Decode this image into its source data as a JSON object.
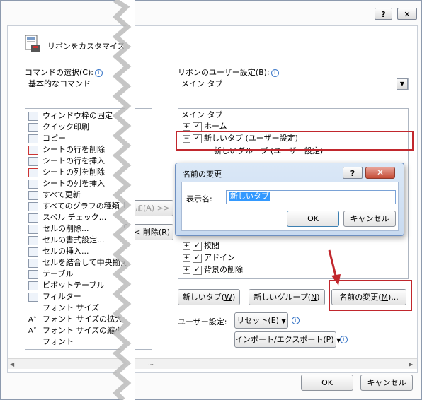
{
  "titlebar": {
    "help": "?",
    "close": "✕"
  },
  "header": {
    "title": "リボンをカスタマイズ"
  },
  "left": {
    "label": "コマンドの選択(",
    "label_key": "C",
    "label_end": "):",
    "combo_value": "基本的なコマンド",
    "items": [
      "ウィンドウ枠の固定",
      "クイック印刷",
      "コピー",
      "シートの行を削除",
      "シートの行を挿入",
      "シートの列を削除",
      "シートの列を挿入",
      "すべて更新",
      "すべてのグラフの種類",
      "スペル チェック...",
      "セルの削除...",
      "セルの書式設定...",
      "セルの挿入...",
      "セルを結合して中央揃え",
      "テーブル",
      "ピボットテーブル",
      "フィルター",
      "フォント サイズ",
      "フォント サイズの拡大",
      "フォント サイズの縮小",
      "フォント"
    ]
  },
  "middle": {
    "add_button": "追加(A) >>",
    "remove_button": "<< 削除(R)"
  },
  "right": {
    "label": "リボンのユーザー設定(",
    "label_key": "B",
    "label_end": "):",
    "combo_value": "メイン タブ",
    "tree_header": "メイン タブ",
    "tree": [
      {
        "expander": "+",
        "checked": "✓",
        "label": "ホーム"
      },
      {
        "expander": "−",
        "checked": "✓",
        "label": "新しいタブ (ユーザー設定)"
      },
      {
        "expander": "",
        "checked": "",
        "label": "新しいグループ (ユーザー設定)"
      },
      {
        "expander": "+",
        "checked": "✓",
        "label": "校閲"
      },
      {
        "expander": "+",
        "checked": "✓",
        "label": "アドイン"
      },
      {
        "expander": "+",
        "checked": "✓",
        "label": "背景の削除"
      }
    ],
    "new_tab_button": "新しいタブ(",
    "new_tab_key": "W",
    "new_group_button": "新しいグループ(",
    "new_group_key": "N",
    "rename_button": "名前の変更(",
    "rename_key": "M",
    "rename_end": ")...",
    "user_setting_label": "ユーザー設定:",
    "reset_button": "リセット(",
    "reset_key": "E",
    "import_button": "インポート/エクスポート(",
    "import_key": "P",
    "close_paren": ")",
    "arrow": "▼"
  },
  "rename_dialog": {
    "title": "名前の変更",
    "help": "?",
    "close": "✕",
    "field_label": "表示名:",
    "field_value": "新しいタブ",
    "ok": "OK",
    "cancel": "キャンセル"
  },
  "footer": {
    "ok": "OK",
    "cancel": "キャンセル"
  },
  "colors": {
    "highlight": "#c1272d",
    "selection": "#3399ff"
  }
}
